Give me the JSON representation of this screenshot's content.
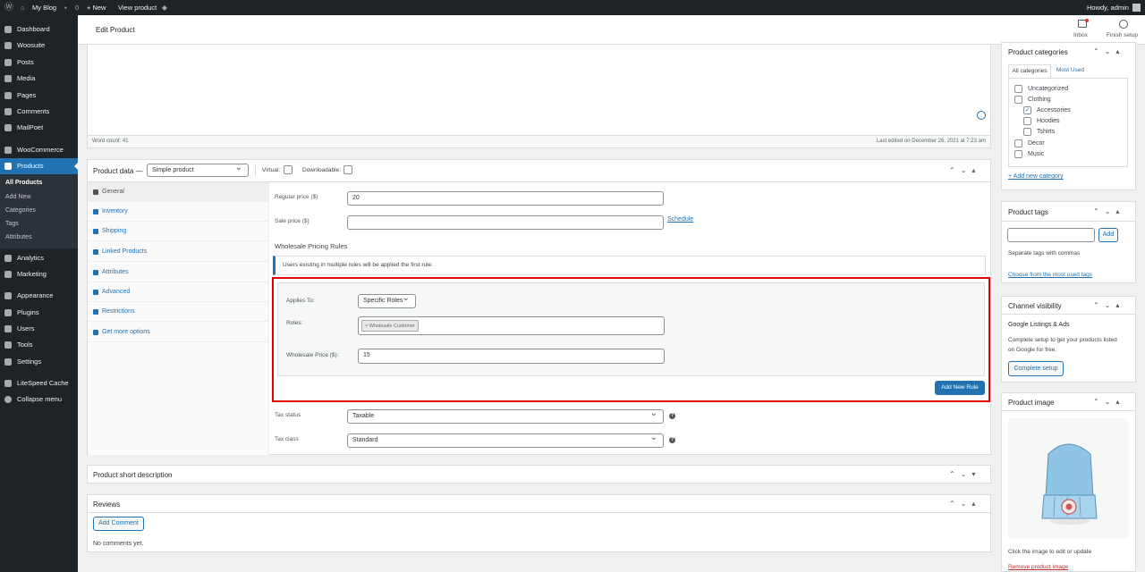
{
  "adminbar": {
    "site_name": "My Blog",
    "comments_count": "0",
    "new_label": "+ New",
    "view_product": "View product",
    "howdy": "Howdy, admin"
  },
  "sidebar": {
    "items": [
      {
        "label": "Dashboard"
      },
      {
        "label": "Woosuite"
      },
      {
        "label": "Posts"
      },
      {
        "label": "Media"
      },
      {
        "label": "Pages"
      },
      {
        "label": "Comments"
      },
      {
        "label": "MailPoet"
      },
      {
        "label": "WooCommerce"
      },
      {
        "label": "Products"
      },
      {
        "label": "Analytics"
      },
      {
        "label": "Marketing"
      },
      {
        "label": "Appearance"
      },
      {
        "label": "Plugins"
      },
      {
        "label": "Users"
      },
      {
        "label": "Tools"
      },
      {
        "label": "Settings"
      },
      {
        "label": "LiteSpeed Cache"
      },
      {
        "label": "Collapse menu"
      }
    ],
    "submenu": [
      "All Products",
      "Add New",
      "Categories",
      "Tags",
      "Attributes"
    ]
  },
  "header": {
    "title": "Edit Product",
    "inbox": "Inbox",
    "finish_setup": "Finish setup"
  },
  "editor": {
    "word_count": "Word count: 41",
    "last_edited": "Last edited on December 26, 2021 at 7:23 am"
  },
  "product_data": {
    "title": "Product data —",
    "type_value": "Simple product",
    "virtual_label": "Virtual:",
    "downloadable_label": "Downloadable:",
    "tabs": [
      "General",
      "Inventory",
      "Shipping",
      "Linked Products",
      "Attributes",
      "Advanced",
      "Restrictions",
      "Get more options"
    ],
    "regular_price_label": "Regular price ($)",
    "regular_price_value": "20",
    "sale_price_label": "Sale price ($)",
    "sale_price_value": "",
    "schedule": "Schedule",
    "wholesale_title": "Wholesale Pricing Rules",
    "wholesale_notice": "Users existing in multiple rules will be applied the first rule.",
    "applies_to_label": "Applies To:",
    "applies_to_value": "Specific Roles",
    "roles_label": "Roles:",
    "role_tag": "× Wholesale Customer",
    "wholesale_price_label": "Wholesale Price ($):",
    "wholesale_price_value": "15",
    "add_rule": "Add New Rule",
    "tax_status_label": "Tax status",
    "tax_status_value": "Taxable",
    "tax_class_label": "Tax class",
    "tax_class_value": "Standard"
  },
  "short_desc": {
    "title": "Product short description"
  },
  "reviews": {
    "title": "Reviews",
    "add_comment": "Add Comment",
    "no_comments": "No comments yet."
  },
  "categories": {
    "title": "Product categories",
    "tab_all": "All categories",
    "tab_most": "Most Used",
    "items": [
      {
        "label": "Uncategorized",
        "checked": false
      },
      {
        "label": "Clothing",
        "checked": false
      },
      {
        "label": "Accessories",
        "checked": true
      },
      {
        "label": "Hoodies",
        "checked": false
      },
      {
        "label": "Tshirts",
        "checked": false
      },
      {
        "label": "Decor",
        "checked": false
      },
      {
        "label": "Music",
        "checked": false
      }
    ],
    "add_new": "+ Add new category"
  },
  "tags": {
    "title": "Product tags",
    "add": "Add",
    "hint": "Separate tags with commas",
    "choose": "Choose from the most used tags"
  },
  "channel": {
    "title": "Channel visibility",
    "heading": "Google Listings & Ads",
    "desc_1": "Complete setup to get your products listed",
    "desc_2": "on Google for free.",
    "button": "Complete setup"
  },
  "image": {
    "title": "Product image",
    "hint": "Click the image to edit or update",
    "remove": "Remove product image"
  },
  "colors": {
    "accent": "#2271b1",
    "sidebar": "#1d2327",
    "highlight": "#e00000"
  }
}
